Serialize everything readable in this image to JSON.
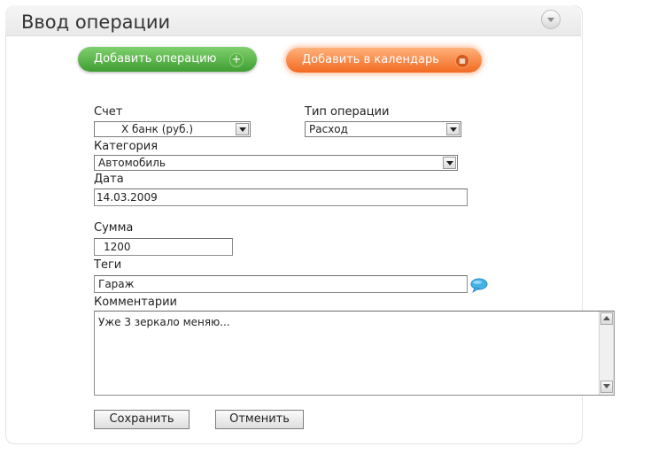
{
  "header": {
    "title": "Ввод операции",
    "collapse_icon": "chevron-down-icon"
  },
  "actions": {
    "add_operation": {
      "label": "Добавить операцию",
      "icon": "plus-icon",
      "color": "#4aa83a"
    },
    "add_calendar": {
      "label": "Добавить в календарь",
      "icon": "calendar-icon",
      "color": "#f26a22"
    }
  },
  "form": {
    "account": {
      "label": "Счет",
      "value": "X   банк (руб.)"
    },
    "operation_type": {
      "label": "Тип операции",
      "value": "Расход"
    },
    "category": {
      "label": "Категория",
      "value": "Автомобиль"
    },
    "date": {
      "label": "Дата",
      "value": "14.03.2009"
    },
    "amount": {
      "label": "Сумма",
      "value": "1200"
    },
    "tags": {
      "label": "Теги",
      "value": "Гараж",
      "icon": "speech-bubble-icon"
    },
    "comments": {
      "label": "Комментарии",
      "value": "Уже 3 зеркало меняю..."
    }
  },
  "buttons": {
    "save_label": "Сохранить",
    "cancel_label": "Отменить"
  }
}
